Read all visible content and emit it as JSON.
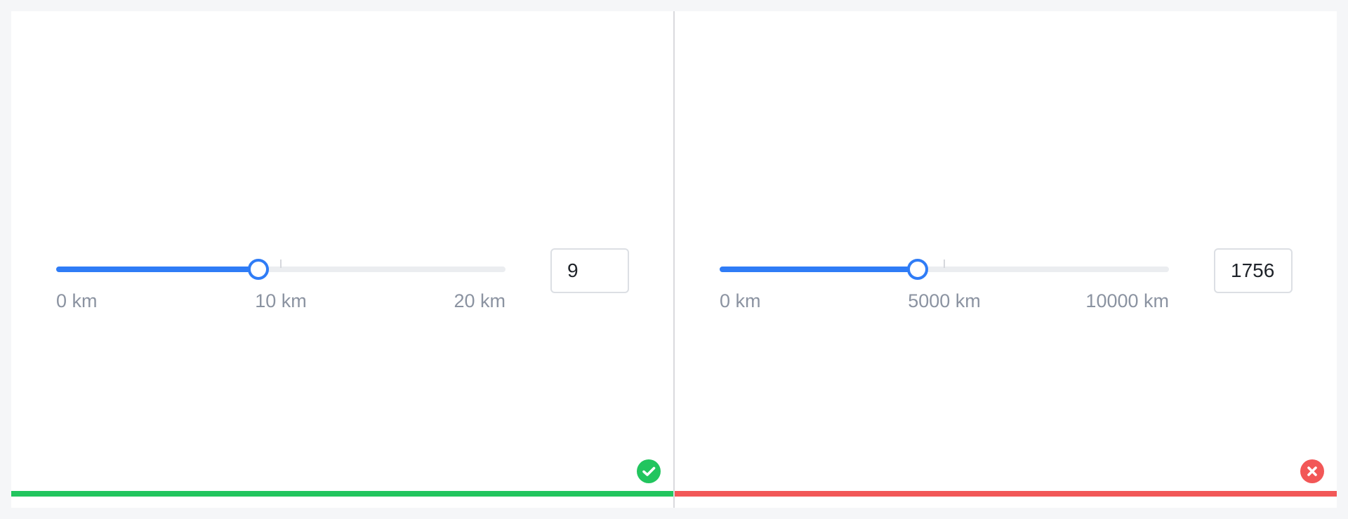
{
  "panels": [
    {
      "slider": {
        "min": 0,
        "max": 20,
        "value": 9,
        "tick": 10,
        "labels": {
          "start": "0 km",
          "mid": "10 km",
          "end": "20 km"
        }
      },
      "input": {
        "value": "9"
      },
      "status": {
        "name": "success",
        "icon": "check-icon",
        "color": "#22c55e"
      }
    },
    {
      "slider": {
        "min": 0,
        "max": 10000,
        "value": 4400,
        "tick": 5000,
        "labels": {
          "start": "0 km",
          "mid": "5000 km",
          "end": "10000 km"
        }
      },
      "input": {
        "value": "1756"
      },
      "status": {
        "name": "error",
        "icon": "close-icon",
        "color": "#f25757"
      }
    }
  ],
  "colors": {
    "accent": "#2f7cf6",
    "track": "#ebedf0",
    "success": "#22c55e",
    "error": "#f25757"
  }
}
